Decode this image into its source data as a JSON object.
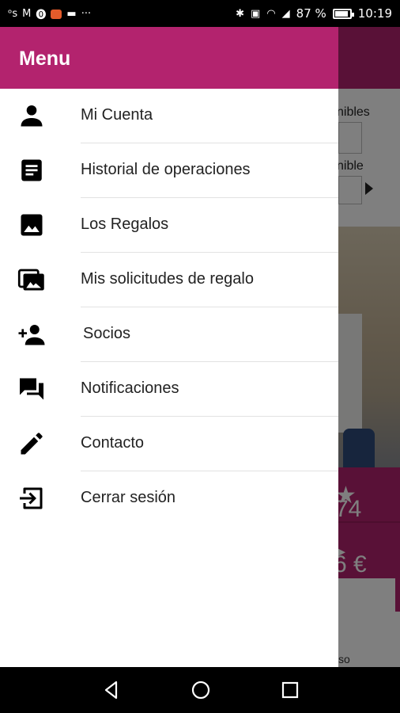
{
  "status_bar": {
    "left_icons": [
      "s-icon",
      "gmail-icon",
      "pinterest-icon",
      "app-icon",
      "folder-icon",
      "more-icon"
    ],
    "more_dots": "···",
    "battery_percent": "87 %",
    "battery_level": 0.87,
    "time": "10:19",
    "right_icons": [
      "bluetooth-icon",
      "nfc-icon",
      "wifi-icon",
      "signal-icon",
      "battery-icon"
    ]
  },
  "drawer": {
    "title": "Menu",
    "items": [
      {
        "label": "Mi Cuenta",
        "icon": "person-icon"
      },
      {
        "label": "Historial de operaciones",
        "icon": "document-icon"
      },
      {
        "label": "Los Regalos",
        "icon": "image-icon"
      },
      {
        "label": "Mis solicitudes de regalo",
        "icon": "images-icon"
      },
      {
        "label": "Socios",
        "icon": "person-add-icon"
      },
      {
        "label": "Notificaciones",
        "icon": "chat-icon"
      },
      {
        "label": "Contacto",
        "icon": "pencil-icon"
      },
      {
        "label": "Cerrar sesión",
        "icon": "logout-icon"
      }
    ]
  },
  "background": {
    "label1": "nibles",
    "label2": "nible",
    "rating": "74",
    "price": "6 €",
    "footer": "so"
  },
  "colors": {
    "brand": "#b3236e",
    "text": "#222222",
    "divider": "#e2e2e2"
  },
  "navbar": {
    "buttons": [
      "back-icon",
      "home-icon",
      "recents-icon"
    ]
  }
}
